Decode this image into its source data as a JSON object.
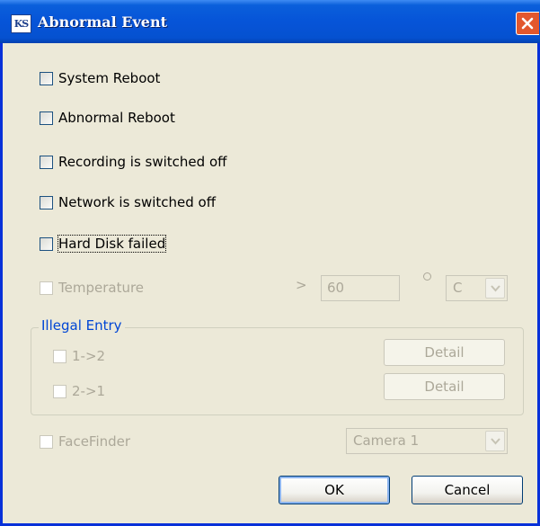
{
  "window": {
    "title": "Abnormal Event",
    "app_icon_text": "KS"
  },
  "checkboxes": [
    {
      "label": "System Reboot",
      "checked": false,
      "enabled": true
    },
    {
      "label": "Abnormal Reboot",
      "checked": false,
      "enabled": true
    },
    {
      "label": "Recording is switched off",
      "checked": false,
      "enabled": true
    },
    {
      "label": "Network is switched off",
      "checked": false,
      "enabled": true
    },
    {
      "label": "Hard Disk failed",
      "checked": false,
      "enabled": true,
      "focused": true
    }
  ],
  "temperature": {
    "label": "Temperature",
    "comparator": ">",
    "value": "60",
    "unit": "C",
    "enabled": false
  },
  "illegal_entry": {
    "title": "Illegal Entry",
    "items": [
      {
        "label": "1->2",
        "button": "Detail"
      },
      {
        "label": "2->1",
        "button": "Detail"
      }
    ]
  },
  "facefinder": {
    "label": "FaceFinder",
    "camera": "Camera 1",
    "enabled": false
  },
  "buttons": {
    "ok": "OK",
    "cancel": "Cancel"
  },
  "colors": {
    "titlebar": "#0654d8",
    "dialog_bg": "#ece9d8",
    "close_button": "#e2572e",
    "group_title": "#0046d5",
    "disabled_text": "#aca899"
  }
}
